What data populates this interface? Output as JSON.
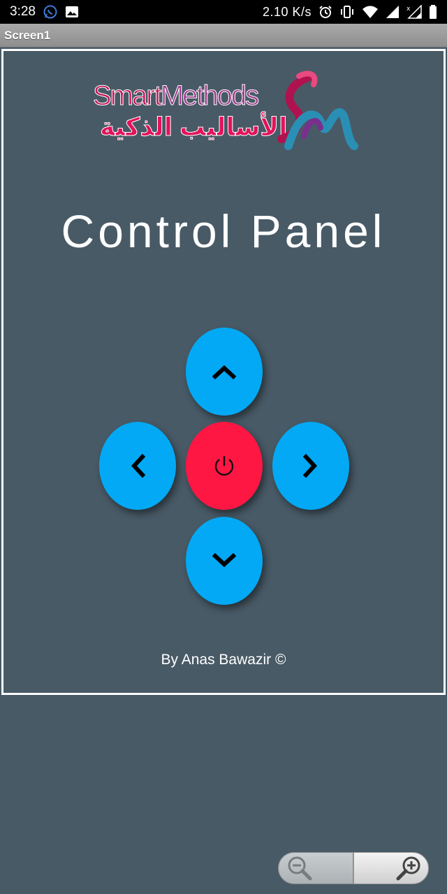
{
  "status_bar": {
    "time": "3:28",
    "network_speed": "2.10 K/s",
    "icons": [
      "whatsapp-icon",
      "image-icon",
      "alarm-icon",
      "vibrate-icon",
      "wifi-icon",
      "signal-icon",
      "signal-x-icon",
      "battery-icon"
    ]
  },
  "app": {
    "title": "Screen1"
  },
  "logo": {
    "text_en_1": "Smart",
    "text_en_2": "Methods",
    "text_ar": "الأساليب الذكية"
  },
  "main": {
    "title": "Control Panel",
    "credit": "By Anas Bawazir ©"
  },
  "controls": {
    "up": "chevron-up-icon",
    "down": "chevron-down-icon",
    "left": "chevron-left-icon",
    "right": "chevron-right-icon",
    "power": "power-icon"
  },
  "colors": {
    "background": "#485a66",
    "direction_button": "#03a9f4",
    "power_button": "#ff1744"
  },
  "zoom": {
    "out": "zoom-out-icon",
    "in": "zoom-in-icon"
  }
}
